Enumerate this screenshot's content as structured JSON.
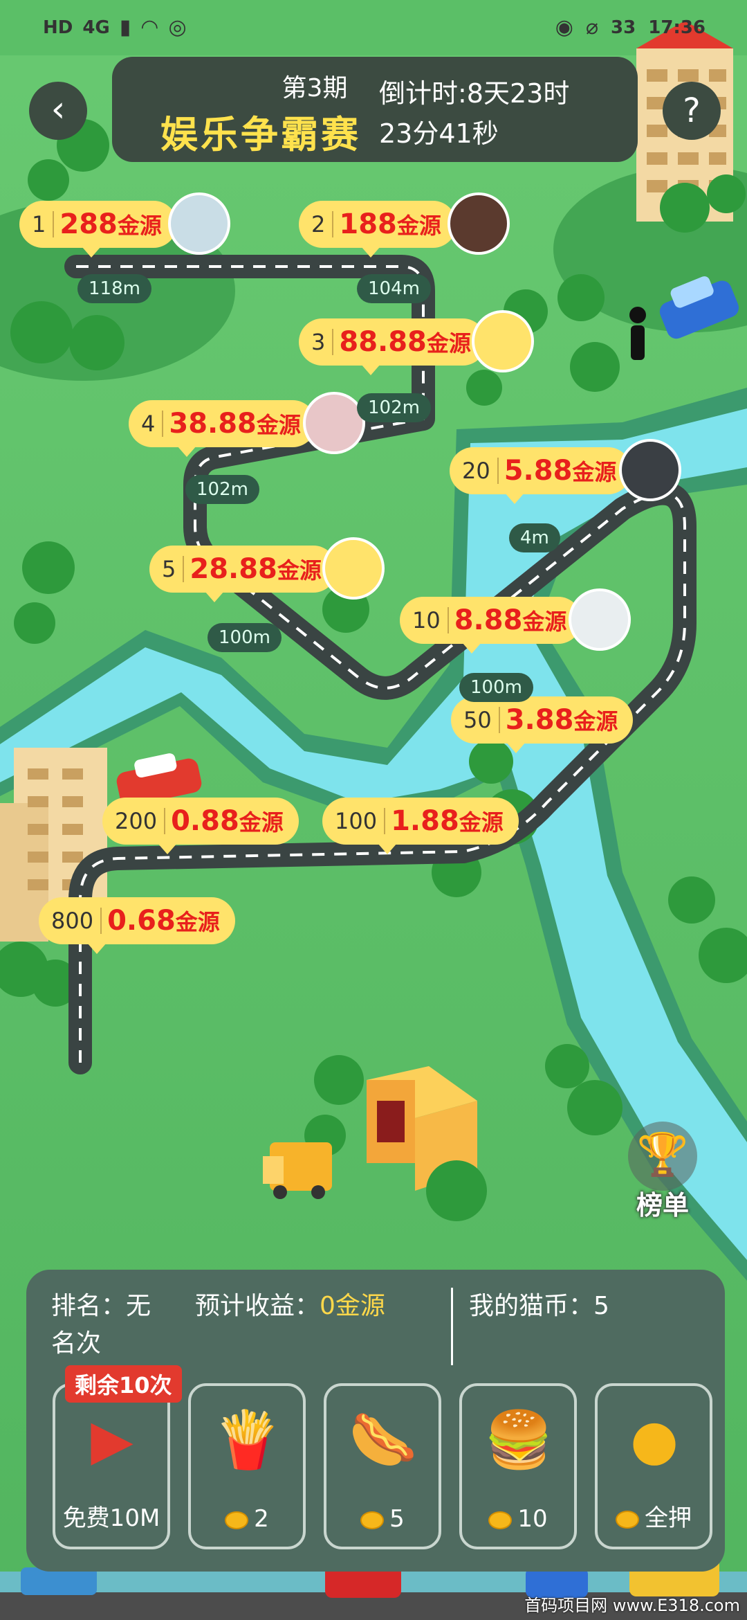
{
  "status_bar": {
    "network": "HD",
    "signal": "4G",
    "battery": "33",
    "time": "17:36"
  },
  "header": {
    "issue": "第3期",
    "title": "娱乐争霸赛",
    "countdown_line1": "倒计时:8天23时",
    "countdown_line2": "23分41秒",
    "back_icon": "chevron-left-icon",
    "help_icon": "question-mark-icon"
  },
  "milestones": [
    {
      "rank": "1",
      "amount": "288",
      "unit": "金源"
    },
    {
      "rank": "2",
      "amount": "188",
      "unit": "金源"
    },
    {
      "rank": "3",
      "amount": "88.88",
      "unit": "金源"
    },
    {
      "rank": "4",
      "amount": "38.88",
      "unit": "金源"
    },
    {
      "rank": "20",
      "amount": "5.88",
      "unit": "金源"
    },
    {
      "rank": "5",
      "amount": "28.88",
      "unit": "金源"
    },
    {
      "rank": "10",
      "amount": "8.88",
      "unit": "金源"
    },
    {
      "rank": "50",
      "amount": "3.88",
      "unit": "金源"
    },
    {
      "rank": "200",
      "amount": "0.88",
      "unit": "金源"
    },
    {
      "rank": "100",
      "amount": "1.88",
      "unit": "金源"
    },
    {
      "rank": "800",
      "amount": "0.68",
      "unit": "金源"
    }
  ],
  "distances": [
    "118m",
    "104m",
    "102m",
    "102m",
    "4m",
    "100m",
    "100m"
  ],
  "leaderboard": {
    "label": "榜单"
  },
  "bottom": {
    "rank_label": "排名：无名次",
    "earn_label": "预计收益：",
    "earn_value": "0金源",
    "coins_label": "我的猫币：5",
    "items": [
      {
        "name": "video",
        "ribbon": "剩余10次",
        "caption": "免费10M"
      },
      {
        "name": "fries",
        "cost": "2"
      },
      {
        "name": "hotdog",
        "cost": "5"
      },
      {
        "name": "burger",
        "cost": "10"
      },
      {
        "name": "all-in",
        "cost": "全押"
      }
    ]
  },
  "watermark": "首码项目网 www.E318.com"
}
